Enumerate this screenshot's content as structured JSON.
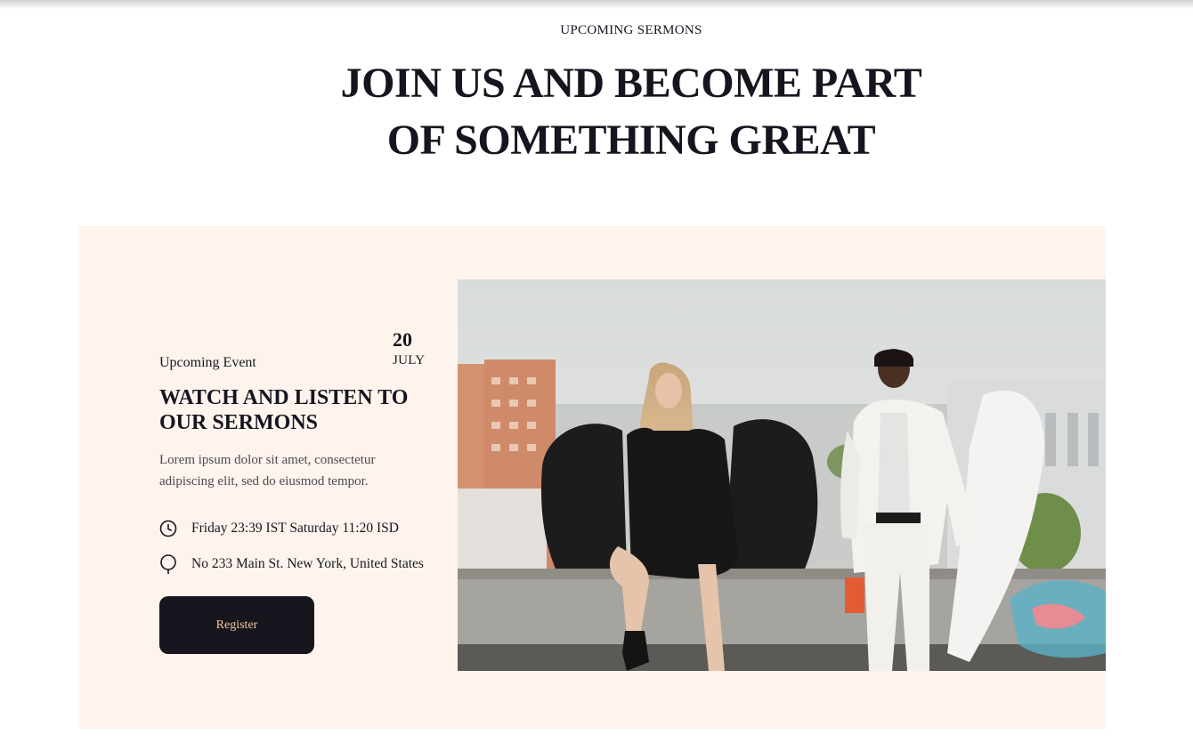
{
  "header": {
    "eyebrow": "UPCOMING SERMONS",
    "headline_line1": "JOIN US AND BECOME PART",
    "headline_line2": "OF SOMETHING GREAT"
  },
  "event": {
    "label": "Upcoming Event",
    "date_day": "20",
    "date_month": "JULY",
    "title": "WATCH AND LISTEN TO OUR SERMONS",
    "description": "Lorem ipsum dolor sit amet, consectetur adipiscing elit, sed do eiusmod tempor.",
    "time_text": "Friday 23:39 IST Saturday 11:20 ISD",
    "time_icon": "clock-icon",
    "location_text": "No 233 Main St. New York, United States",
    "location_icon": "map-pin-icon",
    "register_label": "Register"
  },
  "colors": {
    "card_background": "#fff4ed",
    "text_dark": "#16151f",
    "button_background": "#17161f",
    "button_text": "#f3c99c"
  }
}
